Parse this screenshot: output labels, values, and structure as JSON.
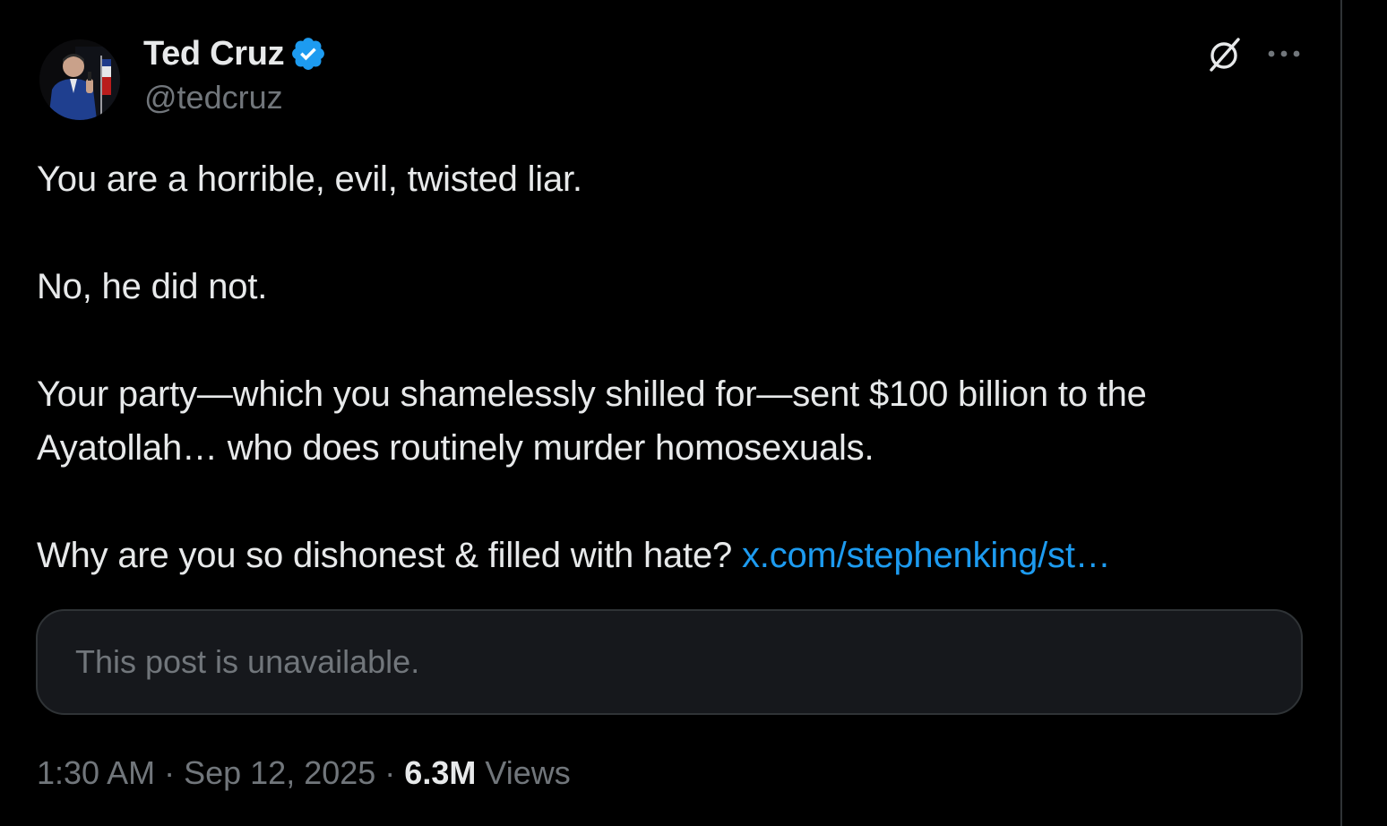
{
  "author": {
    "display_name": "Ted Cruz",
    "handle": "@tedcruz",
    "verified": true
  },
  "post": {
    "paragraphs": [
      "You are a horrible, evil, twisted liar.",
      "No, he did not.",
      "Your party—which you shamelessly shilled for—sent $100 billion to the Ayatollah… who does routinely murder homosexuals.",
      "Why are you so dishonest & filled with hate?"
    ],
    "link_text": "x.com/stephenking/st…",
    "quoted_unavailable": "This post is unavailable."
  },
  "meta": {
    "time": "1:30 AM",
    "separator": " · ",
    "date": "Sep 12, 2025",
    "views_count": "6.3M",
    "views_label": "Views"
  },
  "icons": {
    "verified": "verified-badge-icon",
    "grok": "grok-icon",
    "more": "more-options-icon"
  },
  "colors": {
    "background": "#000000",
    "text_primary": "#e7e9ea",
    "text_secondary": "#71767b",
    "link": "#1d9bf0",
    "verified": "#1d9bf0",
    "card_border": "#2f3336",
    "card_background": "#16181c"
  }
}
